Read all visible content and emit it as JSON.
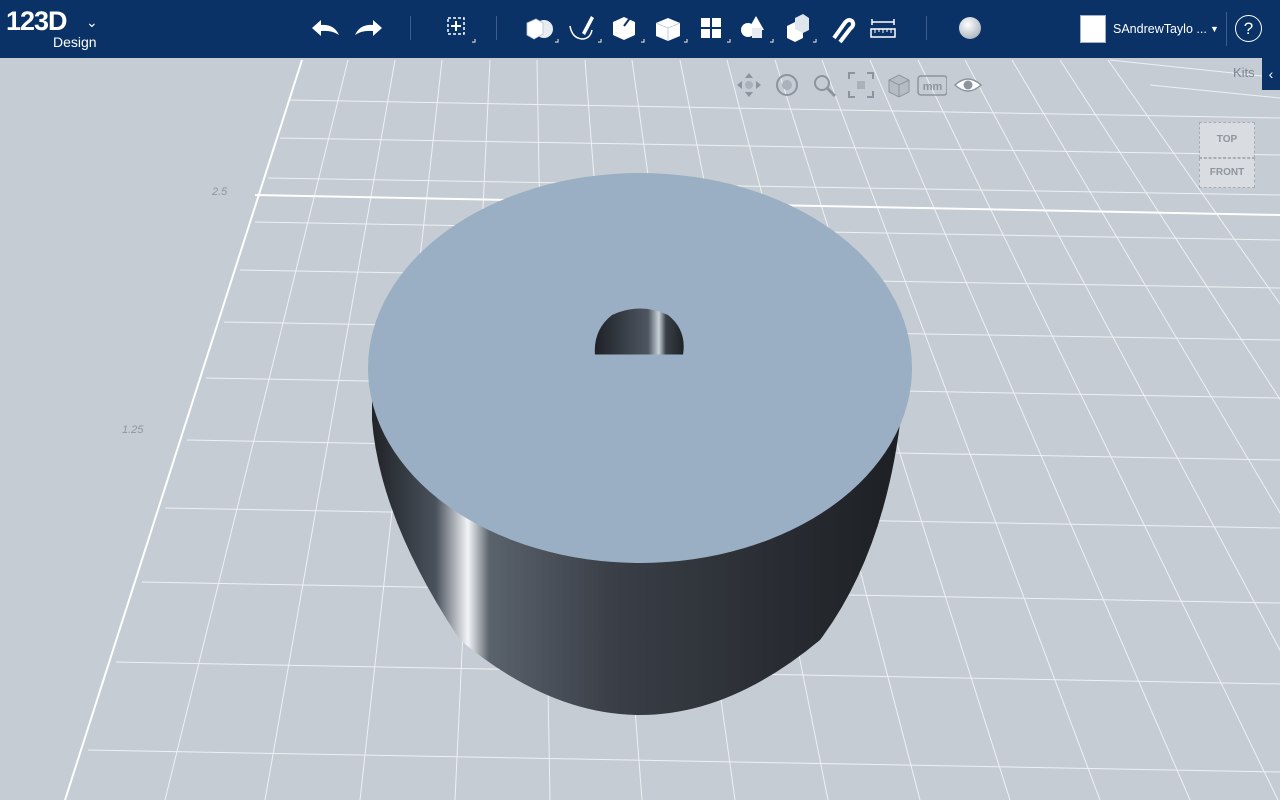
{
  "app": {
    "logo_text": "123D",
    "logo_sub": "Design"
  },
  "toolbar": {
    "undo_icon": "undo-icon",
    "redo_icon": "redo-icon",
    "tools": [
      "transform-icon",
      "primitives-icon",
      "sketch-icon",
      "construct-icon",
      "modify-icon",
      "pattern-icon",
      "grouping-icon",
      "combine-icon",
      "snap-icon",
      "measure-icon",
      "material-icon"
    ]
  },
  "user": {
    "name": "SAndrewTaylo ..."
  },
  "help": {
    "label": "?"
  },
  "nav": {
    "tools": [
      "pan-icon",
      "orbit-icon",
      "zoom-icon",
      "fit-icon",
      "view-mode-icon",
      "units-icon",
      "visibility-icon"
    ],
    "units_label": "mm"
  },
  "kits": {
    "label": "Kits",
    "tab_glyph": "‹"
  },
  "viewcube": {
    "top_label": "TOP",
    "front_label": "FRONT"
  },
  "grid": {
    "labels": [
      "2.5",
      "1.25"
    ]
  },
  "colors": {
    "topbar": "#0b3266",
    "workspace": "#c5ccd3",
    "cylinder_top": "#9aafc3",
    "cylinder_side": "#2b2f36"
  }
}
